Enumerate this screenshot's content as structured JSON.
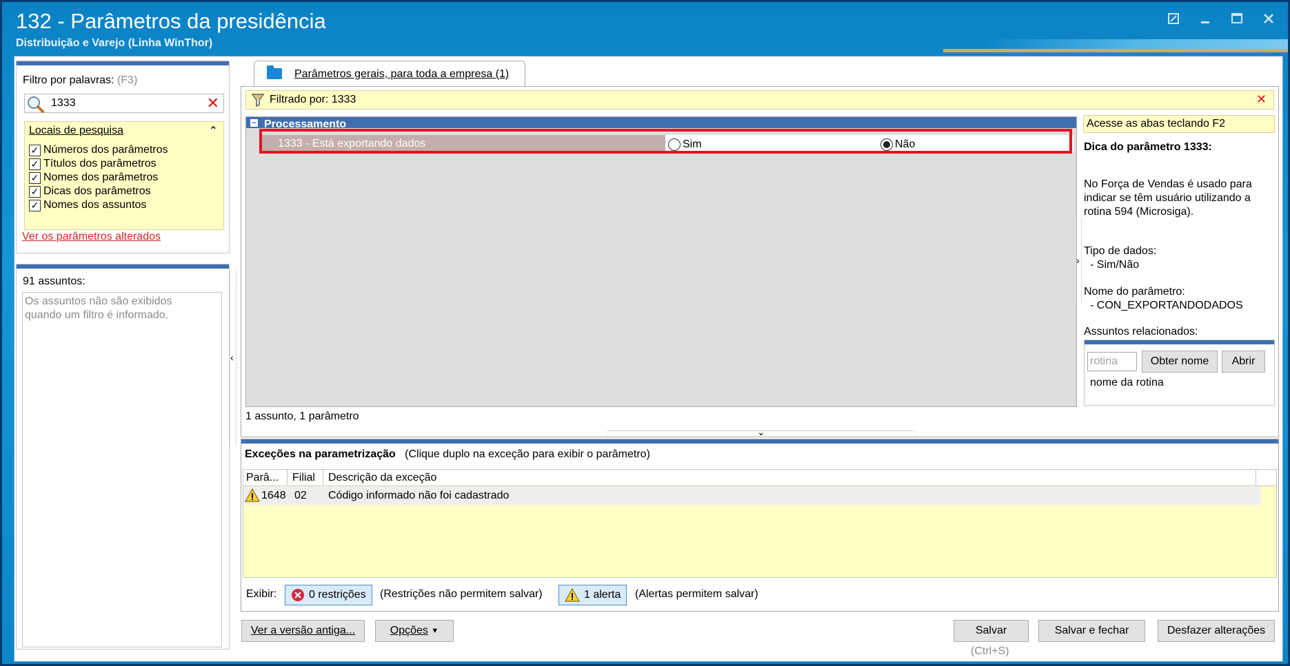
{
  "window": {
    "title": "132 - Parâmetros da presidência",
    "subtitle": "Distribuição e Varejo (Linha WinThor)"
  },
  "filter": {
    "label": "Filtro por palavras:",
    "shortcut": "(F3)",
    "value": "1333",
    "locais_title": "Locais de pesquisa",
    "options": [
      {
        "label": "Números dos parâmetros",
        "checked": true
      },
      {
        "label": "Títulos dos parâmetros",
        "checked": true
      },
      {
        "label": "Nomes dos parâmetros",
        "checked": true
      },
      {
        "label": "Dicas dos parâmetros",
        "checked": true
      },
      {
        "label": "Nomes dos assuntos",
        "checked": true
      }
    ],
    "changed_link": "Ver os parâmetros alterados"
  },
  "subjects": {
    "count_label": "91 assuntos:",
    "note": "Os assuntos não são exibidos quando um filtro é informado."
  },
  "tabs": [
    {
      "label": "Parâmetros gerais, para toda a empresa  (1)",
      "active": true
    }
  ],
  "filterbar": {
    "label": "Filtrado por: 1333"
  },
  "group": {
    "title": "Processamento"
  },
  "param": {
    "label": "1333 - Está exportando dados",
    "options": [
      {
        "label": "Sim",
        "selected": false
      },
      {
        "label": "Não",
        "selected": true
      }
    ]
  },
  "grid_status": "1 assunto, 1 parâmetro",
  "hint": {
    "header": "Acesse as abas teclando F2",
    "title": "Dica do parâmetro 1333:",
    "line1": "No Força de Vendas é usado para",
    "line2": "indicar se têm usuário utilizando a",
    "line3": "rotina 594 (Microsiga).",
    "tipo_label": "Tipo de dados:",
    "tipo_value": "- Sim/Não",
    "nome_label": "Nome do parâmetro:",
    "nome_value": "- CON_EXPORTANDODADOS",
    "assuntos_label": "Assuntos relacionados:",
    "rotina_placeholder": "rotina",
    "obter_button": "Obter nome",
    "abrir_button": "Abrir",
    "rotina_name": "nome da rotina"
  },
  "exceptions": {
    "title": "Exceções na parametrização",
    "subtitle": "(Clique duplo na exceção para exibir o parâmetro)",
    "columns": [
      "Parâ...",
      "Filial",
      "Descrição da exceção"
    ],
    "rows": [
      {
        "param": "1648",
        "filial": "02",
        "descricao": "Código informado não foi cadastrado"
      }
    ],
    "exibir_label": "Exibir:",
    "restricoes_button": "0 restrições",
    "restricoes_note": "(Restrições não permitem salvar)",
    "alertas_button": "1 alerta",
    "alertas_note": "(Alertas permitem salvar)"
  },
  "footer": {
    "old_version": "Ver a versão antiga...",
    "options": "Opções",
    "save": "Salvar",
    "save_hint": "(Ctrl+S)",
    "save_close": "Salvar e fechar",
    "undo": "Desfazer alterações"
  },
  "colors": {
    "accent": "#3e6fb3",
    "highlight_box": "#e01622",
    "yellow": "#fffec4"
  }
}
